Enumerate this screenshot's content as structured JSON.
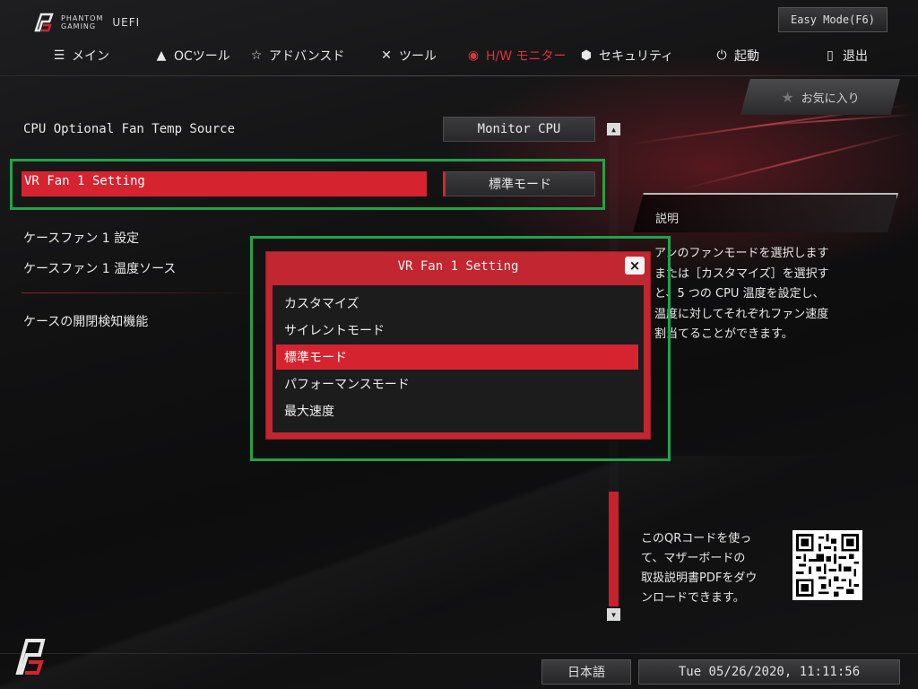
{
  "header": {
    "brand_line1": "PHANTOM",
    "brand_line2": "GAMING",
    "brand_uefi": "UEFI",
    "easy_mode_label": "Easy Mode(F6)"
  },
  "tabs": [
    {
      "label": "メイン",
      "icon": "menu-icon"
    },
    {
      "label": "OCツール",
      "icon": "rocket-icon"
    },
    {
      "label": "アドバンスド",
      "icon": "star-icon"
    },
    {
      "label": "ツール",
      "icon": "tools-icon"
    },
    {
      "label": "H/W モニター",
      "icon": "monitor-icon",
      "active": true
    },
    {
      "label": "セキュリティ",
      "icon": "shield-icon"
    },
    {
      "label": "起動",
      "icon": "power-icon"
    },
    {
      "label": "退出",
      "icon": "exit-icon"
    }
  ],
  "settings": [
    {
      "label": "CPU Optional Fan Temp Source",
      "value": "Monitor CPU"
    },
    {
      "label": "VR Fan 1 Setting",
      "value": "標準モード",
      "selected": true
    },
    {
      "label": "ケースファン 1 設定"
    },
    {
      "label": "ケースファン 1 温度ソース"
    },
    {
      "label": "ケースの開閉検知機能"
    }
  ],
  "favorites_label": "お気に入り",
  "description": {
    "title": "説明",
    "text": "アンのファンモードを選択します\nまたは［カスタマイズ］を選択す\nと、5 つの CPU 温度を設定し、\n温度に対してそれぞれファン速度\n割当てることができます。"
  },
  "qr_text": "このQRコードを使っ\nて、マザーボードの\n取扱説明書PDFをダウ\nンロードできます。",
  "modal": {
    "title": "VR Fan 1 Setting",
    "close_label": "×",
    "options": [
      {
        "label": "カスタマイズ"
      },
      {
        "label": "サイレントモード"
      },
      {
        "label": "標準モード",
        "selected": true
      },
      {
        "label": "パフォーマンスモード"
      },
      {
        "label": "最大速度"
      }
    ]
  },
  "footer": {
    "language": "日本語",
    "datetime": "Tue 05/26/2020, 11:11:56"
  },
  "colors": {
    "accent": "#d52430",
    "highlight_border": "#22a24a",
    "background": "#0c0c0d"
  }
}
